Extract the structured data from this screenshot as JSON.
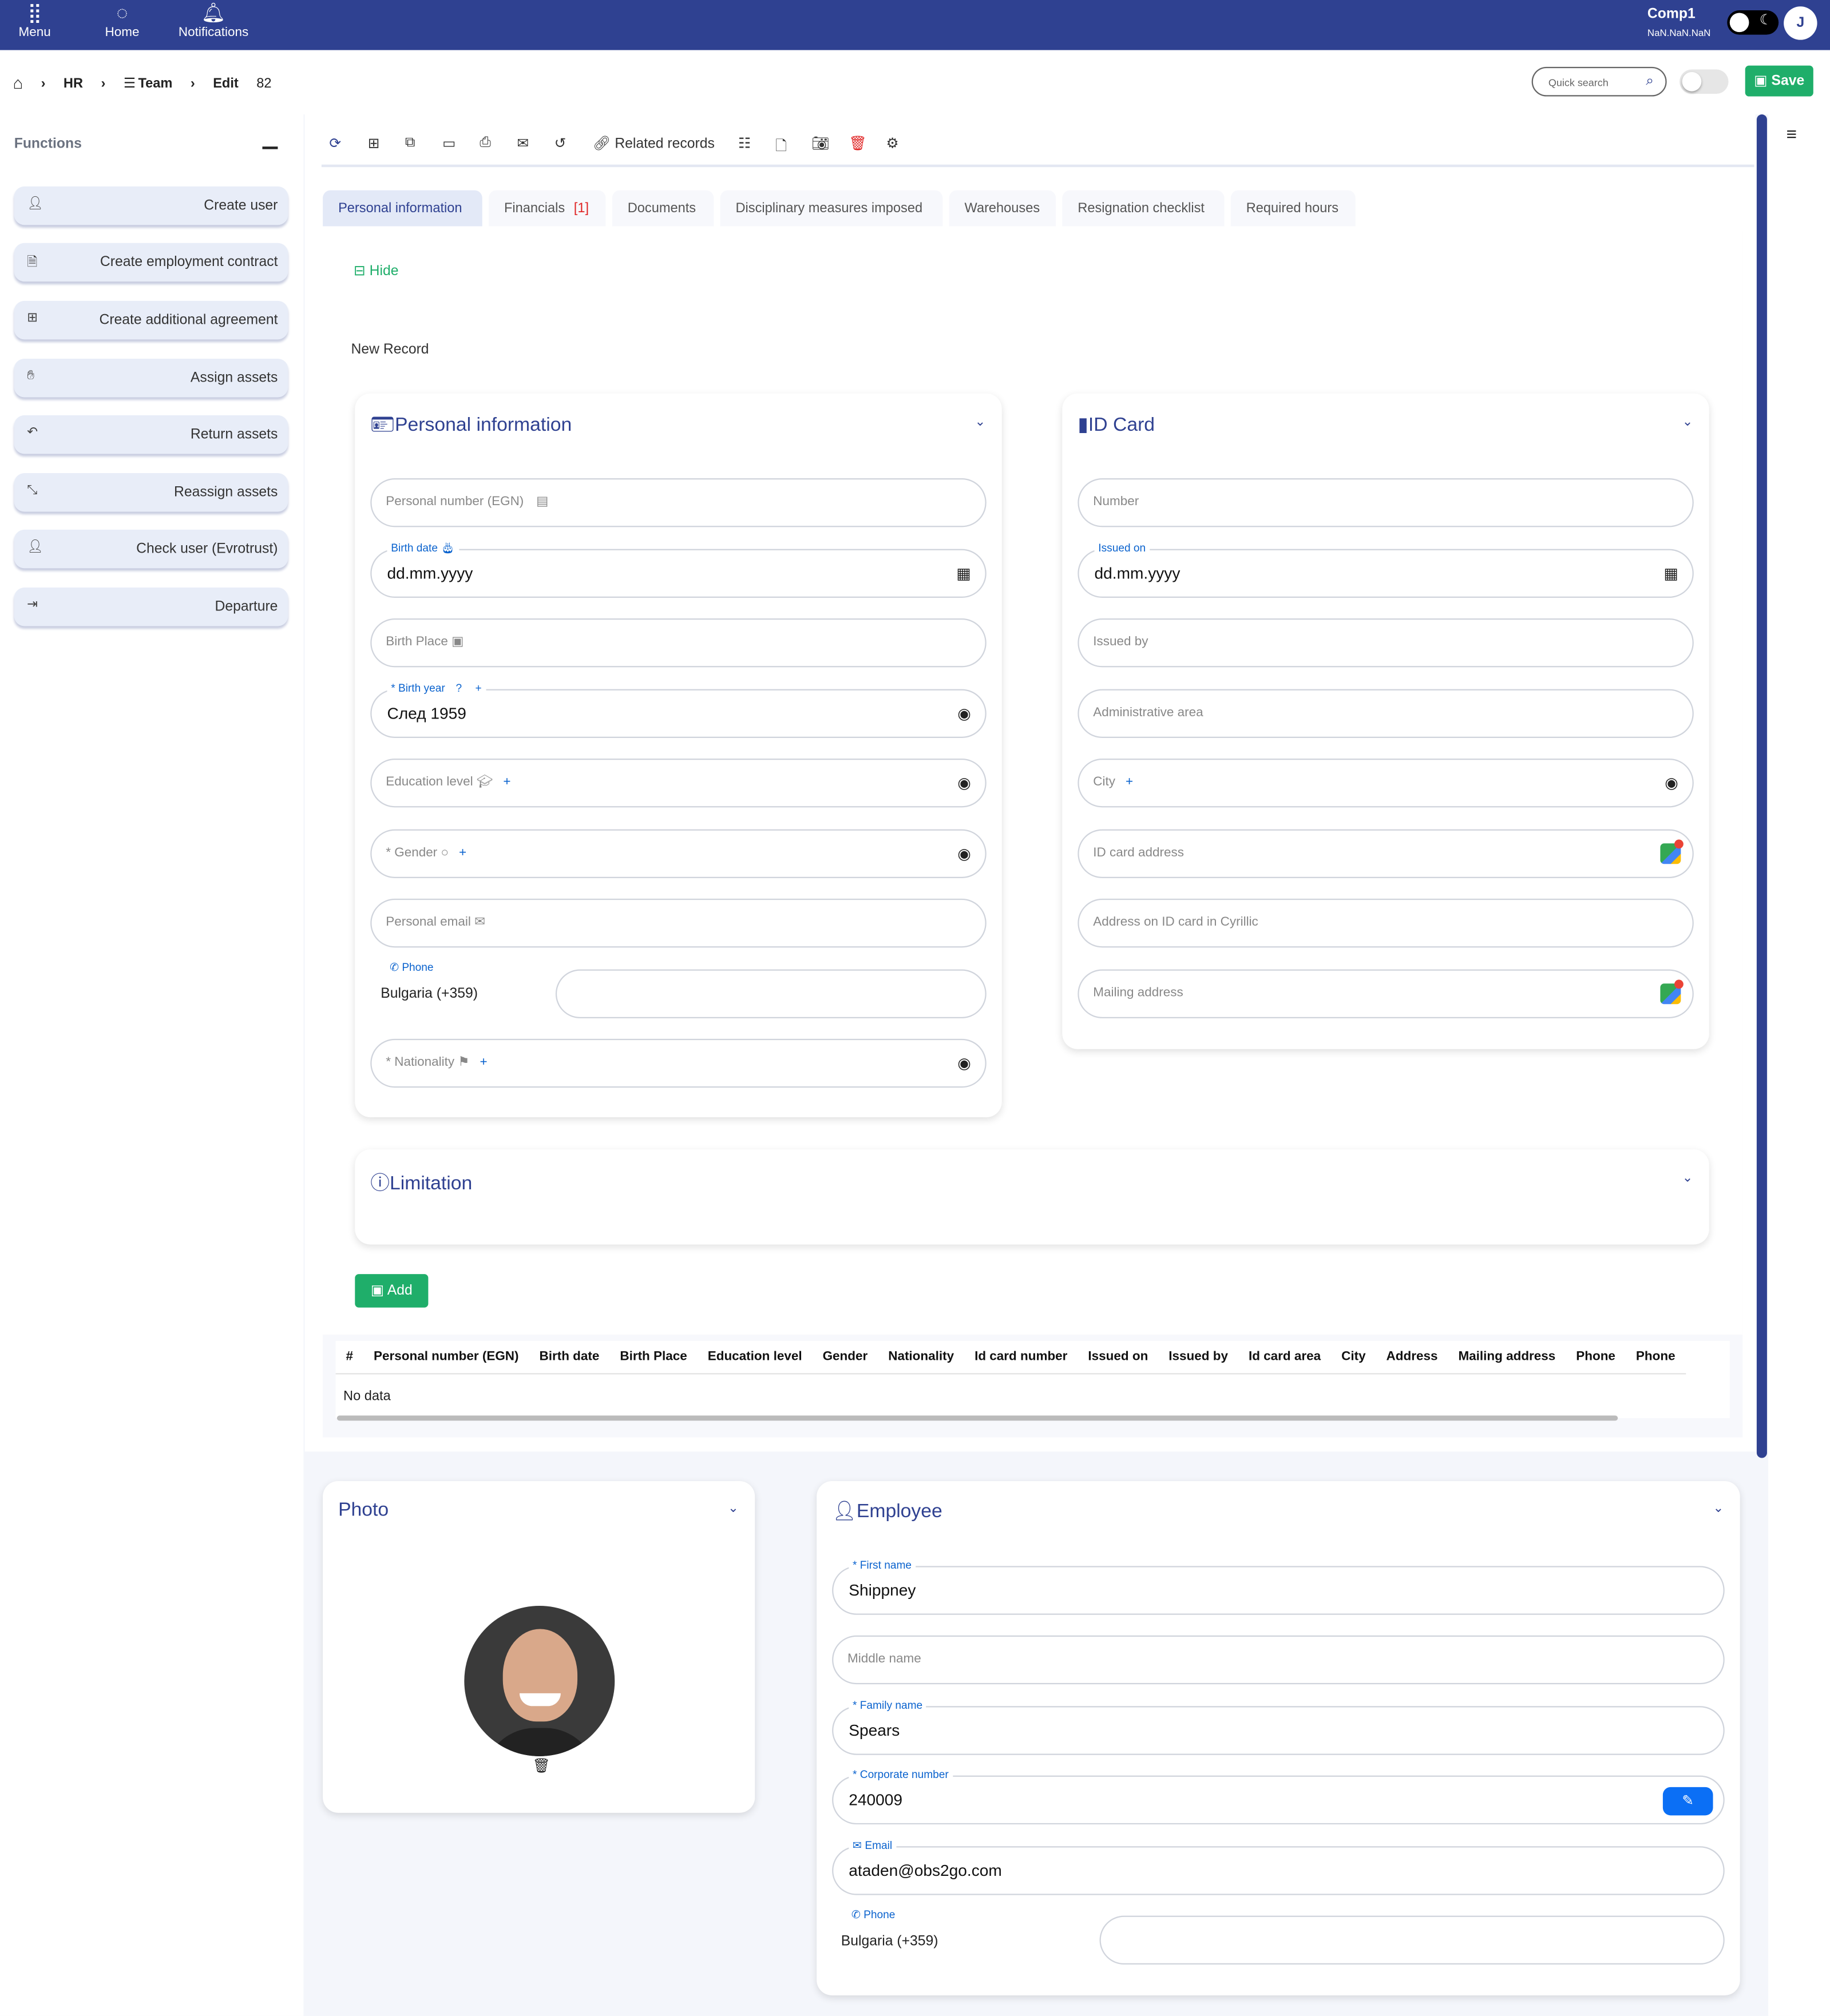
{
  "topbar": {
    "menu": "Menu",
    "home": "Home",
    "notifications": "Notifications",
    "company": "Comp1",
    "company_sub": "NaN.NaN.NaN",
    "user_initial": "J"
  },
  "breadcrumb": {
    "hr": "HR",
    "team": "Team",
    "edit": "Edit",
    "id": "82"
  },
  "header": {
    "search_placeholder": "Quick search",
    "save": "Save"
  },
  "functions": {
    "title": "Functions",
    "items": [
      {
        "label": "Create user",
        "icon": "user-icon"
      },
      {
        "label": "Create employment contract",
        "icon": "document-icon"
      },
      {
        "label": "Create additional agreement",
        "icon": "plus-square-icon"
      },
      {
        "label": "Assign assets",
        "icon": "hand-icon"
      },
      {
        "label": "Return assets",
        "icon": "undo-icon"
      },
      {
        "label": "Reassign assets",
        "icon": "compress-icon"
      },
      {
        "label": "Check user (Evrotrust)",
        "icon": "user-icon"
      },
      {
        "label": "Departure",
        "icon": "sign-out-icon"
      }
    ]
  },
  "toolbar": {
    "related": "Related records"
  },
  "tabs": [
    {
      "label": "Personal information",
      "active": true
    },
    {
      "label": "Financials",
      "badge": "[1]"
    },
    {
      "label": "Documents"
    },
    {
      "label": "Disciplinary measures imposed"
    },
    {
      "label": "Warehouses"
    },
    {
      "label": "Resignation checklist"
    },
    {
      "label": "Required hours"
    }
  ],
  "form": {
    "hide": "Hide",
    "new_record": "New Record"
  },
  "personal": {
    "title": "Personal information",
    "egn": "Personal number (EGN)",
    "birth_date_label": "Birth date",
    "birth_date_value": "dd.mm.yyyy",
    "birth_place": "Birth Place",
    "birth_year_label": "* Birth year",
    "birth_year_help": "?",
    "birth_year_value": "След 1959",
    "education": "Education level",
    "gender": "* Gender",
    "email": "Personal email",
    "phone_label": "Phone",
    "phone_country": "Bulgaria (+359)",
    "nationality": "* Nationality"
  },
  "idcard": {
    "title": "ID Card",
    "number": "Number",
    "issued_on_label": "Issued on",
    "issued_on_value": "dd.mm.yyyy",
    "issued_by": "Issued by",
    "admin_area": "Administrative area",
    "city": "City",
    "address": "ID card address",
    "address_cyr": "Address on ID card in Cyrillic",
    "mailing": "Mailing address"
  },
  "limitation": {
    "title": "Limitation"
  },
  "add_button": "Add",
  "table": {
    "columns": [
      "#",
      "Personal number (EGN)",
      "Birth date",
      "Birth Place",
      "Education level",
      "Gender",
      "Nationality",
      "Id card number",
      "Issued on",
      "Issued by",
      "Id card area",
      "City",
      "Address",
      "Mailing address",
      "Phone",
      "Phone"
    ],
    "empty": "No data"
  },
  "photo": {
    "title": "Photo"
  },
  "employee": {
    "title": "Employee",
    "first_name_label": "* First name",
    "first_name": "Shippney",
    "middle_name": "Middle name",
    "family_name_label": "* Family name",
    "family_name": "Spears",
    "corp_label": "* Corporate number",
    "corp": "240009",
    "email_label": "Email",
    "email": "ataden@obs2go.com",
    "phone_label": "Phone",
    "phone_country": "Bulgaria (+359)"
  },
  "colors": {
    "primary": "#2f4191",
    "save": "#1fae6a",
    "link": "#0b63ce"
  }
}
